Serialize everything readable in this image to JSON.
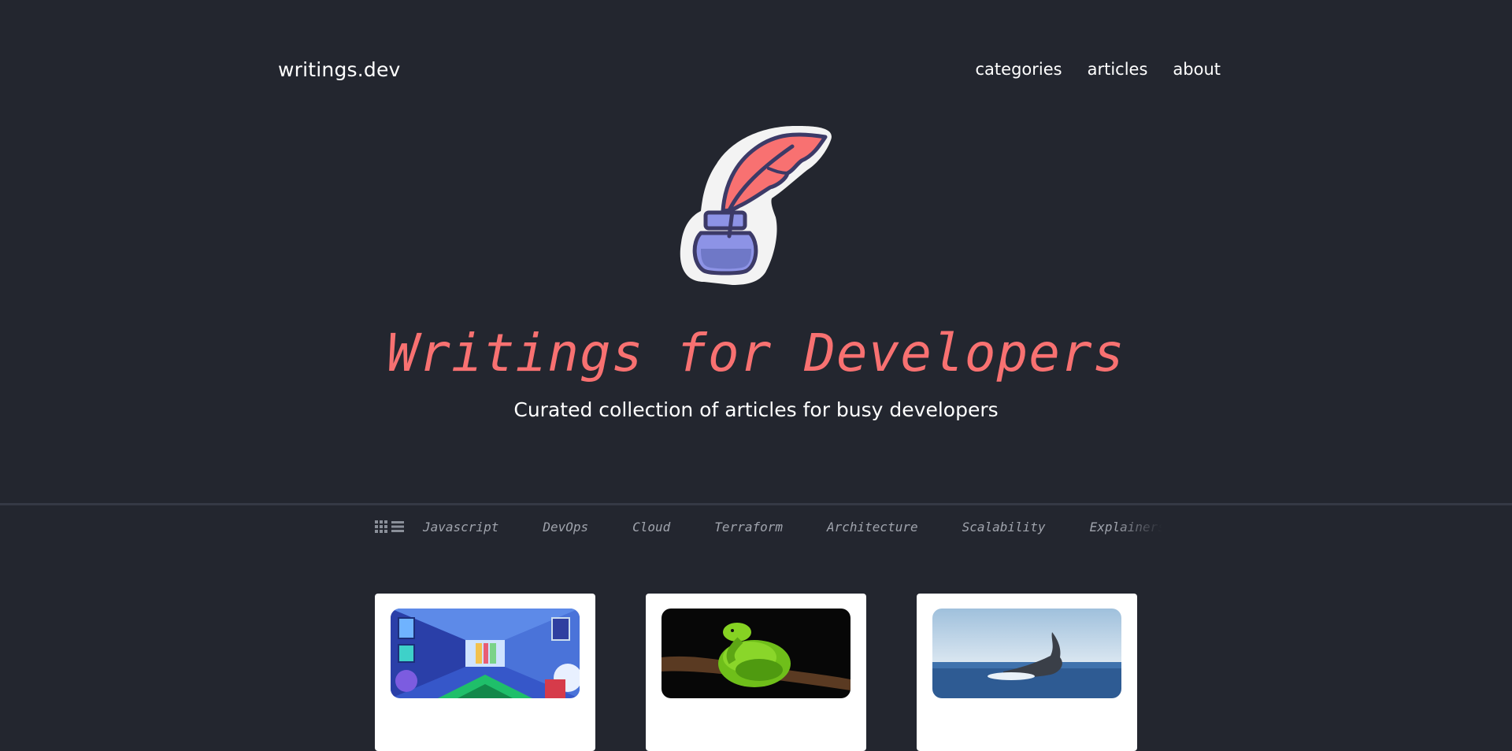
{
  "header": {
    "brand": "writings.dev",
    "nav": [
      {
        "label": "categories"
      },
      {
        "label": "articles"
      },
      {
        "label": "about"
      }
    ]
  },
  "hero": {
    "title": "Writings for Developers",
    "subtitle": "Curated collection of articles for busy developers",
    "logo_icon": "quill-and-inkwell-icon"
  },
  "filters": {
    "view_icons": [
      "grid-view-icon",
      "list-view-icon"
    ],
    "categories": [
      {
        "label": "Javascript"
      },
      {
        "label": "DevOps"
      },
      {
        "label": "Cloud"
      },
      {
        "label": "Terraform"
      },
      {
        "label": "Architecture"
      },
      {
        "label": "Scalability"
      },
      {
        "label": "Explainers"
      }
    ]
  },
  "cards": [
    {
      "image": "colorful-3d-corridor-illustration"
    },
    {
      "image": "green-snake-on-branch-photo"
    },
    {
      "image": "whale-tail-ocean-photo"
    }
  ],
  "colors": {
    "background": "#23262f",
    "accent": "#f87171",
    "muted_text": "#a0a4ad"
  }
}
